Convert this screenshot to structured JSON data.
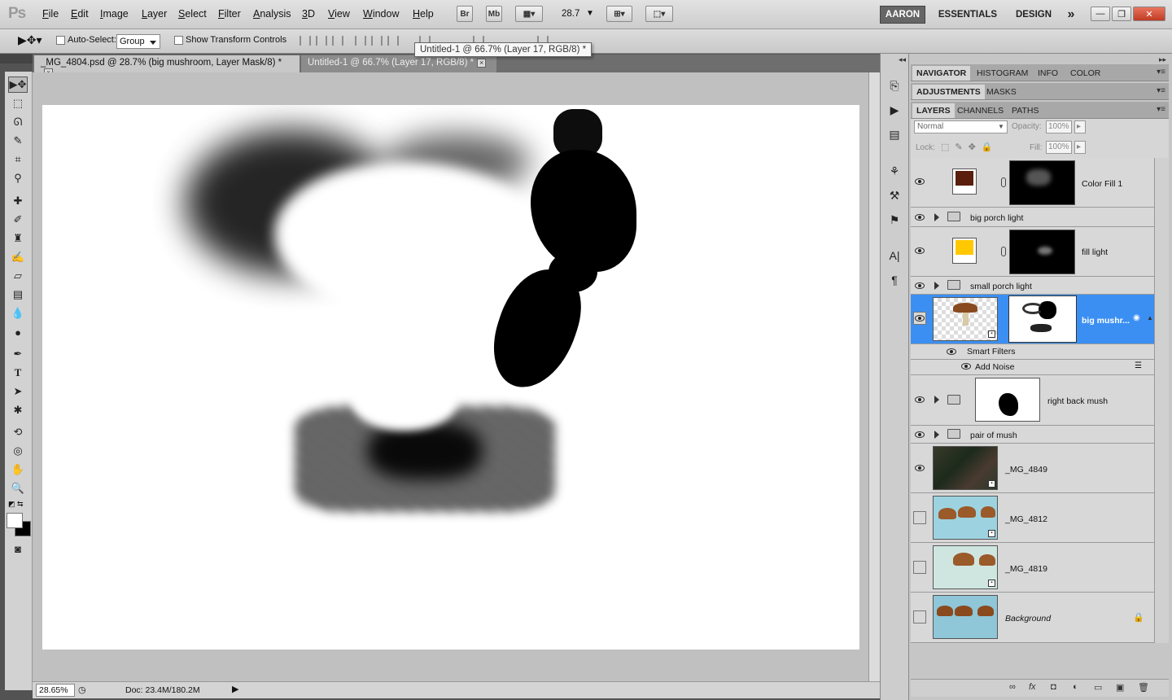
{
  "app": {
    "logo": "Ps"
  },
  "menu": [
    "File",
    "Edit",
    "Image",
    "Layer",
    "Select",
    "Filter",
    "Analysis",
    "3D",
    "View",
    "Window",
    "Help"
  ],
  "appbar": {
    "bridge": "Br",
    "minibridge": "Mb",
    "zoom": "28.7"
  },
  "workspaces": {
    "active": "AARON",
    "items": [
      "ESSENTIALS",
      "DESIGN"
    ],
    "more": "»"
  },
  "window_controls": {
    "minimize": "—",
    "restore": "❐",
    "close": "✕"
  },
  "options": {
    "auto_select_label": "Auto-Select:",
    "auto_select_value": "Group",
    "transform_label": "Show Transform Controls"
  },
  "tooltip": "Untitled-1 @ 66.7% (Layer 17, RGB/8) *",
  "doc_tabs": [
    {
      "label": "_MG_4804.psd @ 28.7% (big mushroom, Layer Mask/8) *",
      "active": true
    },
    {
      "label": "Untitled-1 @ 66.7% (Layer 17, RGB/8) *",
      "active": false
    }
  ],
  "status": {
    "zoom": "28.65%",
    "doc": "Doc: 23.4M/180.2M"
  },
  "panels": {
    "row1": [
      "NAVIGATOR",
      "HISTOGRAM",
      "INFO",
      "COLOR"
    ],
    "row2": [
      "ADJUSTMENTS",
      "MASKS"
    ],
    "row3": [
      "LAYERS",
      "CHANNELS",
      "PATHS"
    ]
  },
  "layers_ctrl": {
    "blend": "Normal",
    "opacity_label": "Opacity:",
    "opacity": "100%",
    "lock_label": "Lock:",
    "fill_label": "Fill:",
    "fill": "100%"
  },
  "layers": [
    {
      "name": "Color Fill 1",
      "kind": "fill",
      "color": "#5a1f0c",
      "visible": true
    },
    {
      "name": "big porch light",
      "kind": "group",
      "visible": true
    },
    {
      "name": "fill light",
      "kind": "fill",
      "color": "#ffc800",
      "visible": true
    },
    {
      "name": "small porch light",
      "kind": "group",
      "visible": true
    },
    {
      "name": "big mushr...",
      "kind": "smart",
      "visible": true,
      "selected": true
    },
    {
      "name": "Smart Filters",
      "kind": "filters"
    },
    {
      "name": "Add Noise",
      "kind": "filter"
    },
    {
      "name": "right back mush",
      "kind": "group-mask",
      "visible": true
    },
    {
      "name": "pair of mush",
      "kind": "group",
      "visible": true
    },
    {
      "name": "_MG_4849",
      "kind": "photo",
      "visible": true
    },
    {
      "name": "_MG_4812",
      "kind": "photo",
      "visible": false
    },
    {
      "name": "_MG_4819",
      "kind": "photo",
      "visible": false
    },
    {
      "name": "Background",
      "kind": "background",
      "visible": false
    }
  ],
  "layers_footer": [
    "∞",
    "fx",
    "◘",
    "◐",
    "▭",
    "▣",
    "🗑"
  ]
}
